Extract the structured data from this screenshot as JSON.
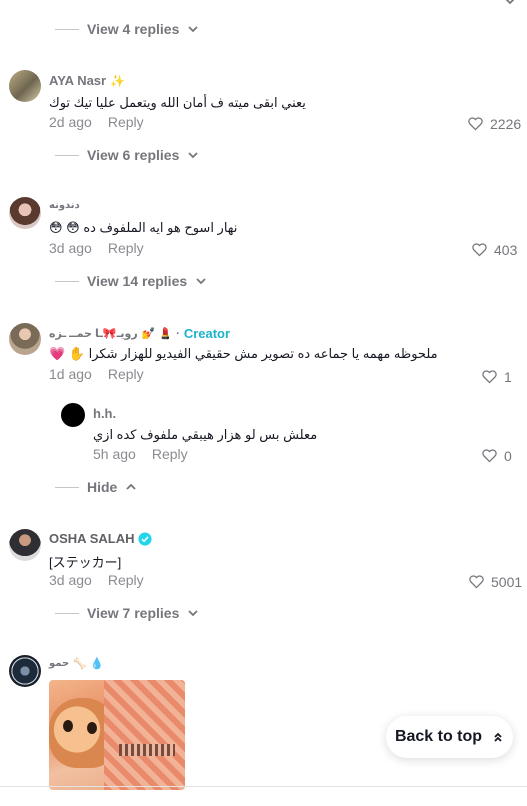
{
  "top": {
    "view4": "View 4 replies"
  },
  "comments": [
    {
      "username": "AYA Nasr",
      "text": "يعني ابقى ميته ف أمان الله ويتعمل عليا تيك توك",
      "time": "2d ago",
      "reply": "Reply",
      "likes": "2226",
      "view_replies": "View 6 replies"
    },
    {
      "username": "دندونه",
      "text": "نهار اسوح هو ايه الملفوف ده",
      "time": "3d ago",
      "reply": "Reply",
      "likes": "403",
      "view_replies": "View 14 replies"
    },
    {
      "username": "رويـ🎀ـا حمــ ـزه",
      "creator_dot": "·",
      "creator_label": "Creator",
      "text": "ملحوظه مهمه يا جماعه ده تصوير مش حقيقي الفيديو للهزار شكرا",
      "time": "1d ago",
      "reply": "Reply",
      "likes": "1",
      "hide": "Hide",
      "sub_reply": {
        "username": "h.h.",
        "text": "معلش بس لو هزار هيبقي ملفوف كده ازي",
        "time": "5h ago",
        "reply": "Reply",
        "likes": "0"
      }
    },
    {
      "username": "OSHA SALAH",
      "text": "[ステッカー]",
      "time": "3d ago",
      "reply": "Reply",
      "likes": "5001",
      "view_replies": "View 7 replies"
    },
    {
      "username": "حمو"
    }
  ],
  "back_to_top": "Back to top",
  "colors": {
    "creator": "#1cb3c9",
    "meta": "#8a8b91",
    "text": "#161823"
  }
}
